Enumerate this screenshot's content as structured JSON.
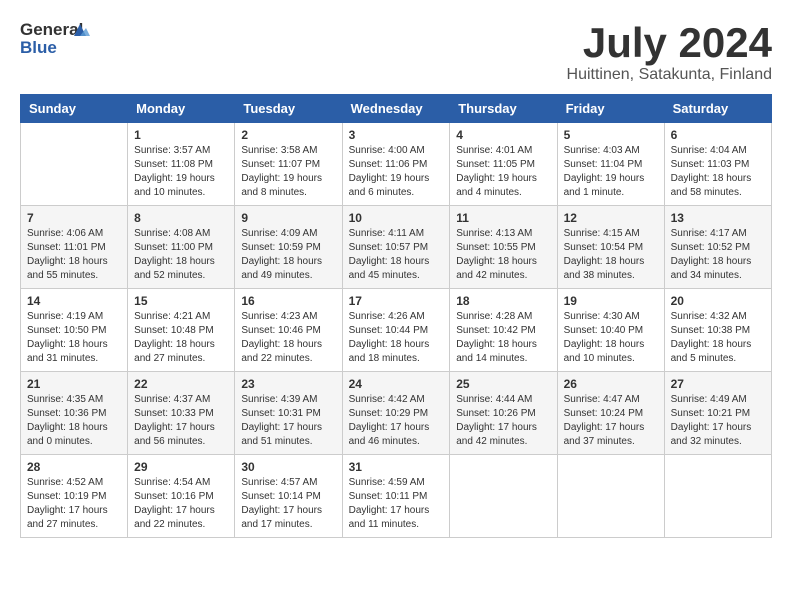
{
  "logo": {
    "text_general": "General",
    "text_blue": "Blue"
  },
  "title": {
    "month_year": "July 2024",
    "location": "Huittinen, Satakunta, Finland"
  },
  "weekdays": [
    "Sunday",
    "Monday",
    "Tuesday",
    "Wednesday",
    "Thursday",
    "Friday",
    "Saturday"
  ],
  "weeks": [
    [
      {
        "day": "",
        "info": ""
      },
      {
        "day": "1",
        "info": "Sunrise: 3:57 AM\nSunset: 11:08 PM\nDaylight: 19 hours\nand 10 minutes."
      },
      {
        "day": "2",
        "info": "Sunrise: 3:58 AM\nSunset: 11:07 PM\nDaylight: 19 hours\nand 8 minutes."
      },
      {
        "day": "3",
        "info": "Sunrise: 4:00 AM\nSunset: 11:06 PM\nDaylight: 19 hours\nand 6 minutes."
      },
      {
        "day": "4",
        "info": "Sunrise: 4:01 AM\nSunset: 11:05 PM\nDaylight: 19 hours\nand 4 minutes."
      },
      {
        "day": "5",
        "info": "Sunrise: 4:03 AM\nSunset: 11:04 PM\nDaylight: 19 hours\nand 1 minute."
      },
      {
        "day": "6",
        "info": "Sunrise: 4:04 AM\nSunset: 11:03 PM\nDaylight: 18 hours\nand 58 minutes."
      }
    ],
    [
      {
        "day": "7",
        "info": "Sunrise: 4:06 AM\nSunset: 11:01 PM\nDaylight: 18 hours\nand 55 minutes."
      },
      {
        "day": "8",
        "info": "Sunrise: 4:08 AM\nSunset: 11:00 PM\nDaylight: 18 hours\nand 52 minutes."
      },
      {
        "day": "9",
        "info": "Sunrise: 4:09 AM\nSunset: 10:59 PM\nDaylight: 18 hours\nand 49 minutes."
      },
      {
        "day": "10",
        "info": "Sunrise: 4:11 AM\nSunset: 10:57 PM\nDaylight: 18 hours\nand 45 minutes."
      },
      {
        "day": "11",
        "info": "Sunrise: 4:13 AM\nSunset: 10:55 PM\nDaylight: 18 hours\nand 42 minutes."
      },
      {
        "day": "12",
        "info": "Sunrise: 4:15 AM\nSunset: 10:54 PM\nDaylight: 18 hours\nand 38 minutes."
      },
      {
        "day": "13",
        "info": "Sunrise: 4:17 AM\nSunset: 10:52 PM\nDaylight: 18 hours\nand 34 minutes."
      }
    ],
    [
      {
        "day": "14",
        "info": "Sunrise: 4:19 AM\nSunset: 10:50 PM\nDaylight: 18 hours\nand 31 minutes."
      },
      {
        "day": "15",
        "info": "Sunrise: 4:21 AM\nSunset: 10:48 PM\nDaylight: 18 hours\nand 27 minutes."
      },
      {
        "day": "16",
        "info": "Sunrise: 4:23 AM\nSunset: 10:46 PM\nDaylight: 18 hours\nand 22 minutes."
      },
      {
        "day": "17",
        "info": "Sunrise: 4:26 AM\nSunset: 10:44 PM\nDaylight: 18 hours\nand 18 minutes."
      },
      {
        "day": "18",
        "info": "Sunrise: 4:28 AM\nSunset: 10:42 PM\nDaylight: 18 hours\nand 14 minutes."
      },
      {
        "day": "19",
        "info": "Sunrise: 4:30 AM\nSunset: 10:40 PM\nDaylight: 18 hours\nand 10 minutes."
      },
      {
        "day": "20",
        "info": "Sunrise: 4:32 AM\nSunset: 10:38 PM\nDaylight: 18 hours\nand 5 minutes."
      }
    ],
    [
      {
        "day": "21",
        "info": "Sunrise: 4:35 AM\nSunset: 10:36 PM\nDaylight: 18 hours\nand 0 minutes."
      },
      {
        "day": "22",
        "info": "Sunrise: 4:37 AM\nSunset: 10:33 PM\nDaylight: 17 hours\nand 56 minutes."
      },
      {
        "day": "23",
        "info": "Sunrise: 4:39 AM\nSunset: 10:31 PM\nDaylight: 17 hours\nand 51 minutes."
      },
      {
        "day": "24",
        "info": "Sunrise: 4:42 AM\nSunset: 10:29 PM\nDaylight: 17 hours\nand 46 minutes."
      },
      {
        "day": "25",
        "info": "Sunrise: 4:44 AM\nSunset: 10:26 PM\nDaylight: 17 hours\nand 42 minutes."
      },
      {
        "day": "26",
        "info": "Sunrise: 4:47 AM\nSunset: 10:24 PM\nDaylight: 17 hours\nand 37 minutes."
      },
      {
        "day": "27",
        "info": "Sunrise: 4:49 AM\nSunset: 10:21 PM\nDaylight: 17 hours\nand 32 minutes."
      }
    ],
    [
      {
        "day": "28",
        "info": "Sunrise: 4:52 AM\nSunset: 10:19 PM\nDaylight: 17 hours\nand 27 minutes."
      },
      {
        "day": "29",
        "info": "Sunrise: 4:54 AM\nSunset: 10:16 PM\nDaylight: 17 hours\nand 22 minutes."
      },
      {
        "day": "30",
        "info": "Sunrise: 4:57 AM\nSunset: 10:14 PM\nDaylight: 17 hours\nand 17 minutes."
      },
      {
        "day": "31",
        "info": "Sunrise: 4:59 AM\nSunset: 10:11 PM\nDaylight: 17 hours\nand 11 minutes."
      },
      {
        "day": "",
        "info": ""
      },
      {
        "day": "",
        "info": ""
      },
      {
        "day": "",
        "info": ""
      }
    ]
  ]
}
